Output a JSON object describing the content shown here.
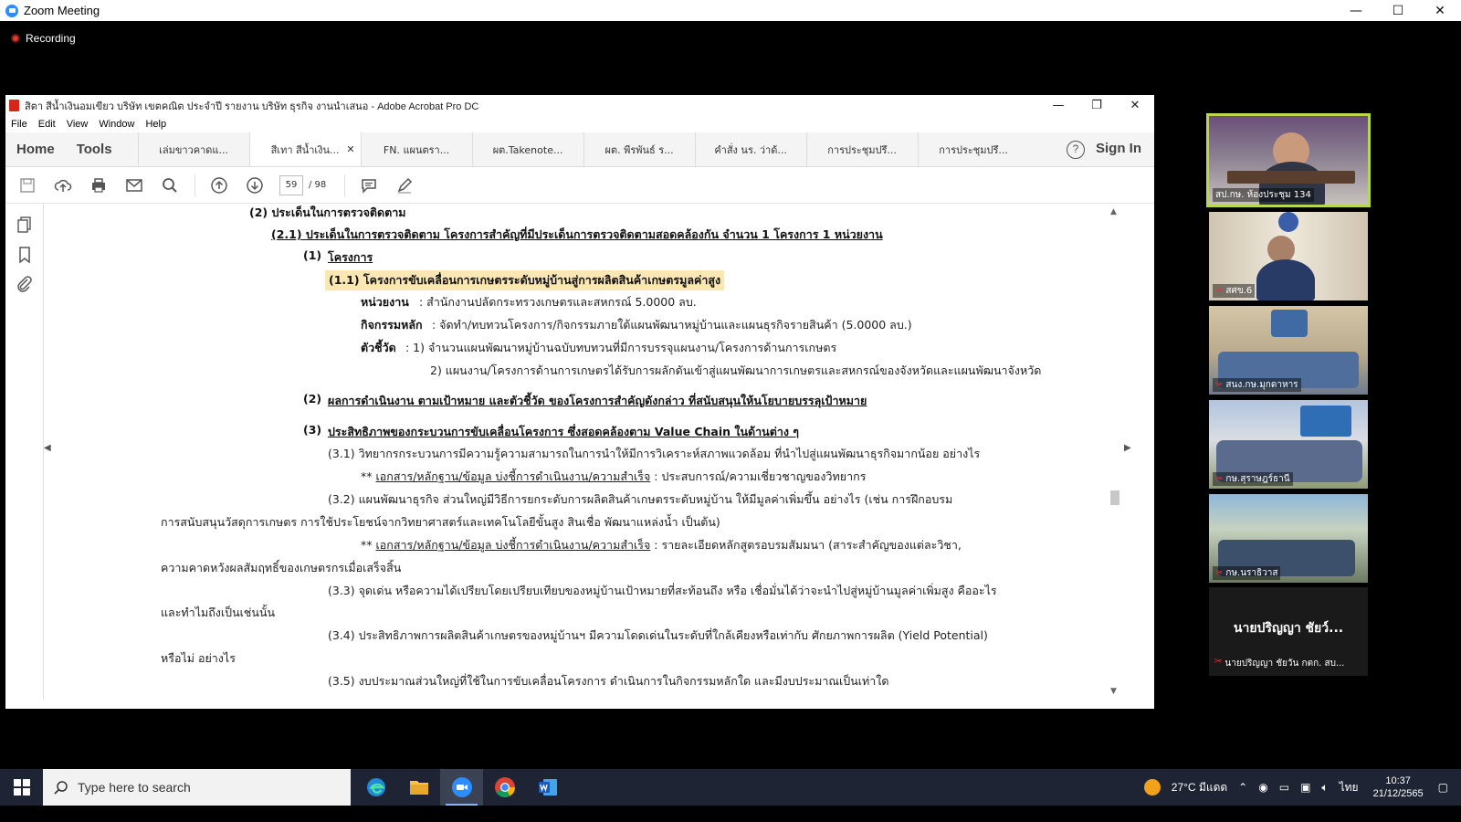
{
  "zoom": {
    "title": "Zoom Meeting",
    "recording_label": "Recording",
    "controls": {
      "minimize": "—",
      "maximize": "☐",
      "close": "✕"
    }
  },
  "acrobat": {
    "title": "สิตา สีน้ำเงินอมเขียว บริษัท เขตคณิต ประจำปี รายงาน บริษัท ธุรกิจ งานนำเสนอ - Adobe Acrobat Pro DC",
    "menu": [
      "File",
      "Edit",
      "View",
      "Window",
      "Help"
    ],
    "home": "Home",
    "tools": "Tools",
    "tabs": [
      {
        "label": "เล่มขาวคาดแ..."
      },
      {
        "label": "สีเทา สีน้ำเงิน...",
        "active": true
      },
      {
        "label": "FN. แผนตรา..."
      },
      {
        "label": "ผต.Takenote..."
      },
      {
        "label": "ผต. พีรพันธ์ ร..."
      },
      {
        "label": "คำสั่ง นร. ว่าด้..."
      },
      {
        "label": "การประชุมปรึ..."
      },
      {
        "label": "การประชุมปรึ..."
      }
    ],
    "tab_close": "✕",
    "help": "?",
    "sign_in": "Sign In",
    "page_current": "59",
    "page_total": "/ 98"
  },
  "document": {
    "h2": "(2) ประเด็นในการตรวจติดตาม",
    "h2_1": "(2.1) ประเด็นในการตรวจติดตาม โครงการสำคัญที่มีประเด็นการตรวจติดตามสอดคล้องกัน จำนวน 1 โครงการ 1 หน่วยงาน",
    "project_num": "(1)",
    "project_label": "โครงการ",
    "p1_1": "(1.1) โครงการขับเคลื่อนการเกษตรระดับหมู่บ้านสู่การผลิตสินค้าเกษตรมูลค่าสูง",
    "agency_label": "หน่วยงาน",
    "agency_value": ": สำนักงานปลัดกระทรวงเกษตรและสหกรณ์ 5.0000 ลบ.",
    "activity_label": "กิจกรรมหลัก",
    "activity_value": ": จัดทำ/ทบทวนโครงการ/กิจกรรมภายใต้แผนพัฒนาหมู่บ้านและแผนธุรกิจรายสินค้า (5.0000 ลบ.)",
    "indicator_label": "ตัวชี้วัด",
    "indicator_1": ":     1) จำนวนแผนพัฒนาหมู่บ้านฉบับทบทวนที่มีการบรรจุแผนงาน/โครงการด้านการเกษตร",
    "indicator_2": "2) แผนงาน/โครงการด้านการเกษตรได้รับการผลักดันเข้าสู่แผนพัฒนาการเกษตรและสหกรณ์ของจังหวัดและแผนพัฒนาจังหวัด",
    "s2_num": "(2)",
    "s2": "ผลการดำเนินงาน ตามเป้าหมาย และตัวชี้วัด ของโครงการสำคัญดังกล่าว ที่สนับสนุนให้นโยบายบรรลุเป้าหมาย",
    "s3_num": "(3)",
    "s3": "ประสิทธิภาพของกระบวนการขับเคลื่อนโครงการ ซึ่งสอดคล้องตาม Value Chain ในด้านต่าง ๆ",
    "s3_1": "(3.1)   วิทยากรกระบวนการมีความรู้ความสามารถในการนำให้มีการวิเคราะห์สภาพแวดล้อม ที่นำไปสู่แผนพัฒนาธุรกิจมากน้อย อย่างไร",
    "evidence_prefix": "**",
    "evidence_label": "เอกสาร/หลักฐาน/ข้อมูล บ่งชี้การดำเนินงาน/ความสำเร็จ",
    "s3_1_evidence": " : ประสบการณ์/ความเชี่ยวชาญของวิทยากร",
    "s3_2_a": "(3.2) แผนพัฒนาธุรกิจ ส่วนใหญ่มีวิธีการยกระดับการผลิตสินค้าเกษตรระดับหมู่บ้าน ให้มีมูลค่าเพิ่มขึ้น อย่างไร (เช่น การฝึกอบรม",
    "s3_2_b": "การสนับสนุนวัสดุการเกษตร การใช้ประโยชน์จากวิทยาศาสตร์และเทคโนโลยีขั้นสูง สินเชื่อ พัฒนาแหล่งน้ำ เป็นต้น)",
    "s3_2_evidence": " : รายละเอียดหลักสูตรอบรมสัมมนา (สาระสำคัญของแต่ละวิชา,",
    "s3_2_c": "ความคาดหวังผลสัมฤทธิ์ของเกษตรกรเมื่อเสร็จสิ้น",
    "s3_3_a": "(3.3) จุดเด่น หรือความได้เปรียบโดยเปรียบเทียบของหมู่บ้านเป้าหมายที่สะท้อนถึง หรือ เชื่อมั่นได้ว่าจะนำไปสู่หมู่บ้านมูลค่าเพิ่มสูง คืออะไร",
    "s3_3_b": "และทำไมถึงเป็นเช่นนั้น",
    "s3_4_a": "(3.4) ประสิทธิภาพการผลิตสินค้าเกษตรของหมู่บ้านฯ มีความโดดเด่นในระดับที่ใกล้เคียงหรือเท่ากับ ศักยภาพการผลิต (Yield Potential)",
    "s3_4_b": "หรือไม่ อย่างไร",
    "s3_5": "(3.5) งบประมาณส่วนใหญ่ที่ใช้ในการขับเคลื่อนโครงการ ดำเนินการในกิจกรรมหลักใด และมีงบประมาณเป็นเท่าใด"
  },
  "participants": [
    {
      "name": "สป.กษ. ห้องประชุม 134",
      "active": true,
      "muted": false
    },
    {
      "name": "สศข.6",
      "muted": true
    },
    {
      "name": "สนง.กษ.มุกดาหาร",
      "muted": true
    },
    {
      "name": "กษ.สุราษฎร์ธานี",
      "muted": true
    },
    {
      "name": "กษ.นราธิวาส",
      "muted": true
    }
  ],
  "name_tile": {
    "display_name": "นายปริญญา ชัยว์...",
    "full_name": "นายปริญญา ชัยวัน กตก. สบ..."
  },
  "taskbar": {
    "search_placeholder": "Type here to search",
    "weather": "27°C มีแดด",
    "language": "ไทย",
    "time": "10:37",
    "date": "21/12/2565"
  }
}
